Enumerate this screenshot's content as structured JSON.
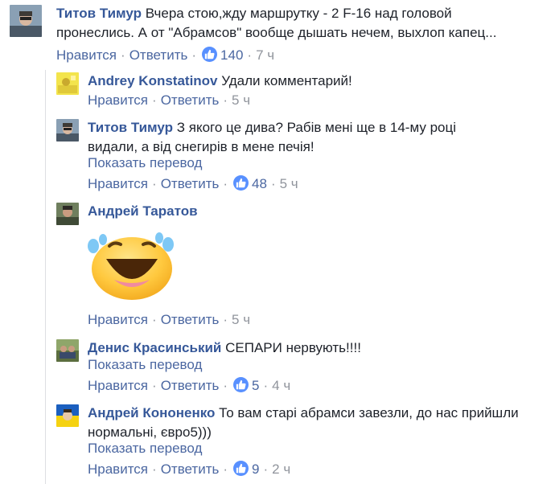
{
  "comments": [
    {
      "author": "Титов Тимур",
      "text": "Вчера стою,жду маршрутку - 2 F-16 над головой пронеслись. А от \"Абрамсов\" вообще дышать нечем, выхлоп капец...",
      "like_label": "Нравится",
      "reply_label": "Ответить",
      "like_count": "140",
      "time": "7 ч"
    },
    {
      "author": "Andrey Konstatinov",
      "text": "Удали комментарий!",
      "like_label": "Нравится",
      "reply_label": "Ответить",
      "time": "5 ч"
    },
    {
      "author": "Титов Тимур",
      "text": "З якого це дива? Рабів мені ще в 14-му році видали, а від снегирів в мене печія!",
      "translate_label": "Показать перевод",
      "like_label": "Нравится",
      "reply_label": "Ответить",
      "like_count": "48",
      "time": "5 ч"
    },
    {
      "author": "Андрей Таратов",
      "sticker": "laughing-tears-sticker",
      "like_label": "Нравится",
      "reply_label": "Ответить",
      "time": "5 ч"
    },
    {
      "author": "Денис Красинський",
      "text": "СЕПАРИ нервують!!!!",
      "translate_label": "Показать перевод",
      "like_label": "Нравится",
      "reply_label": "Ответить",
      "like_count": "5",
      "time": "4 ч"
    },
    {
      "author": "Андрей Кононенко",
      "text": "То вам старі абрамси завезли, до нас прийшли нормальні, євро5)))",
      "translate_label": "Показать перевод",
      "like_label": "Нравится",
      "reply_label": "Ответить",
      "like_count": "9",
      "time": "2 ч"
    }
  ],
  "colors": {
    "link": "#4b67a1",
    "author": "#365899",
    "meta": "#90949c",
    "like_badge": "#5890ff"
  },
  "icons": {
    "like": "thumbs-up-icon"
  }
}
